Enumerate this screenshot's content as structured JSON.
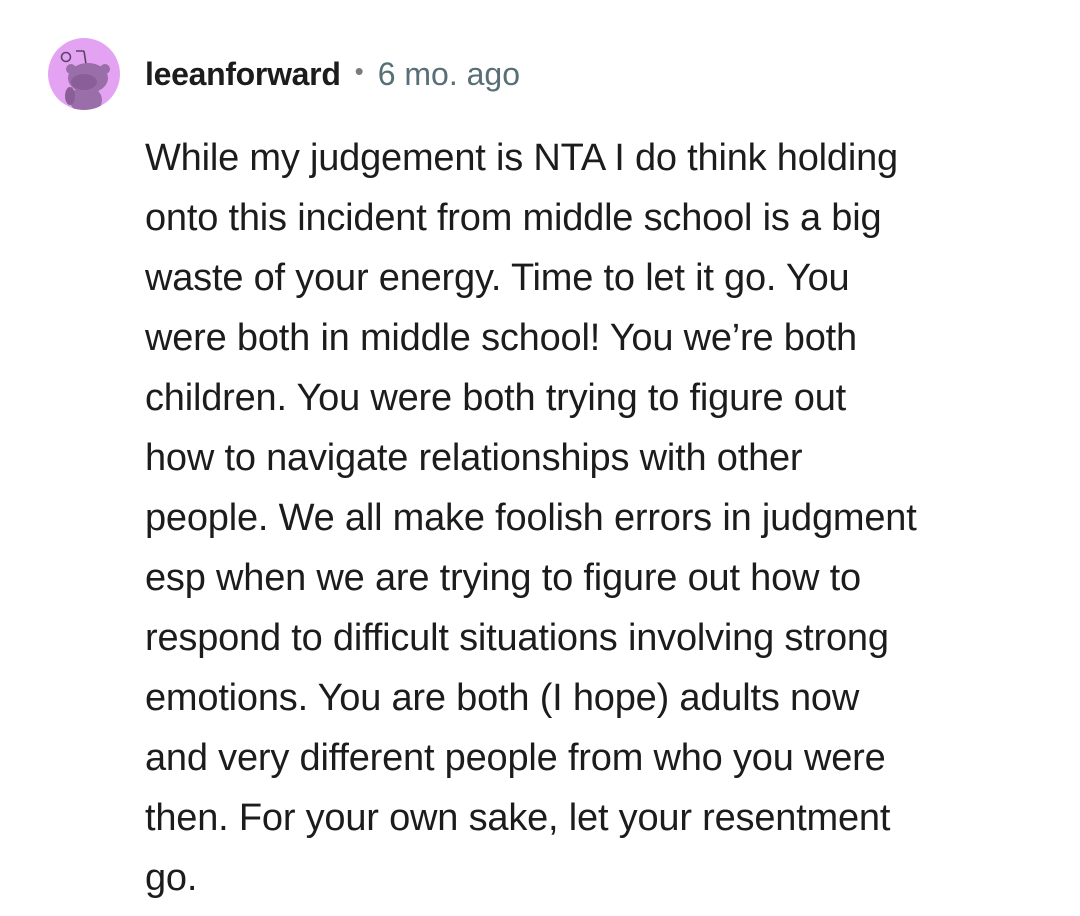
{
  "comment": {
    "author": "leeanforward",
    "separator": "•",
    "timestamp": "6 mo. ago",
    "avatar_icon": "snoo-avatar-icon",
    "avatar_color": "#e4a3f2",
    "body_lines": [
      "While my judgement is NTA I do think holding",
      "onto this incident from middle school is a big",
      "waste of your energy. Time to let it go. You",
      "were both in middle school! You we’re both",
      "children. You were both trying to figure out",
      "how to navigate relationships with other",
      "people. We all make foolish errors in judgment",
      "esp when we are trying to figure out how to",
      "respond to difficult situations involving strong",
      "emotions. You are both (I hope) adults now",
      "and very different people from who you were",
      "then. For your own sake, let your resentment",
      "go."
    ]
  }
}
